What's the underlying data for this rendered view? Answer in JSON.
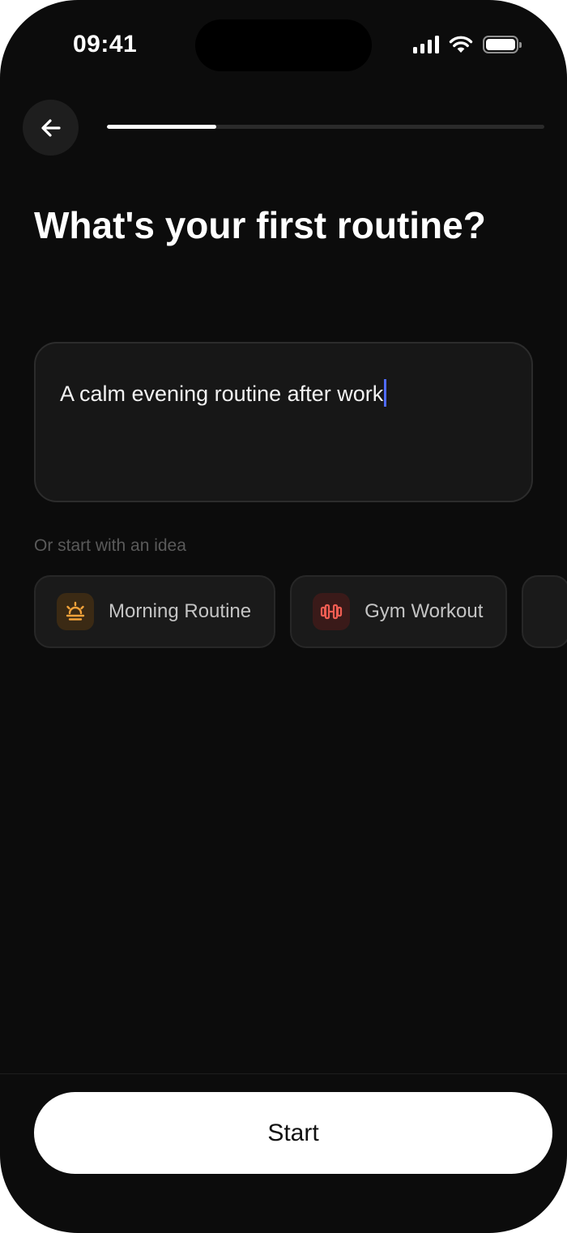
{
  "status_bar": {
    "time": "09:41"
  },
  "header": {
    "back_icon": "arrow-left-icon",
    "progress": 0.25
  },
  "main": {
    "title": "What's your first routine?",
    "input": {
      "value": "A calm evening routine after work",
      "caret_color": "#4f6bff"
    },
    "ideas_label": "Or start with an idea",
    "ideas": [
      {
        "label": "Morning Routine",
        "icon": "sunrise-icon",
        "icon_color": "#f5a33a",
        "icon_bg": "#3b2a14"
      },
      {
        "label": "Gym Workout",
        "icon": "dumbbell-icon",
        "icon_color": "#ef5d52",
        "icon_bg": "#3a1a19"
      }
    ]
  },
  "footer": {
    "start_label": "Start"
  }
}
